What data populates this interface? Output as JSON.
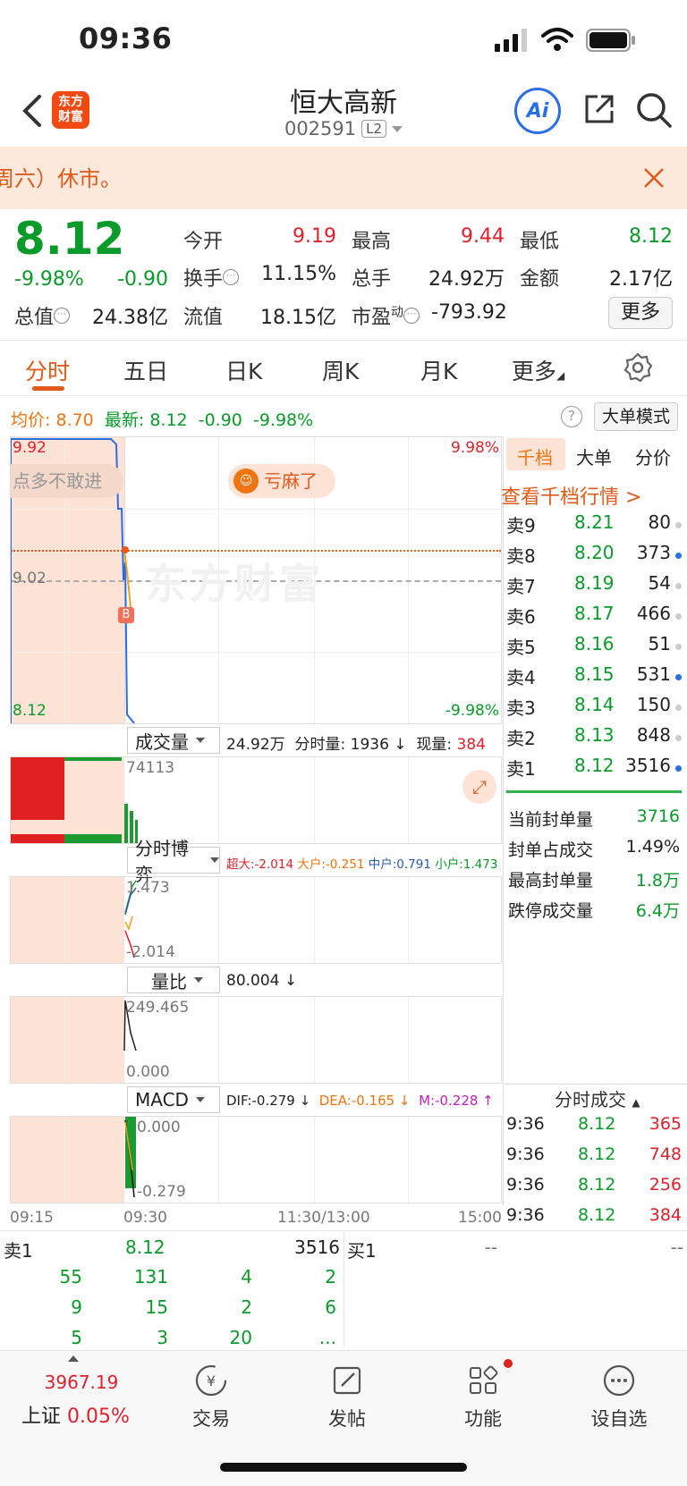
{
  "status": {
    "time": "09:36"
  },
  "header": {
    "logo_line1": "东方",
    "logo_line2": "财富",
    "title": "恒大高新",
    "code": "002591",
    "level": "L2",
    "ai_label": "Ai"
  },
  "notice": {
    "text": "周六）休市。"
  },
  "quote": {
    "price": "8.12",
    "pct": "-9.98%",
    "change": "-0.90",
    "fields": [
      {
        "label": "今开",
        "value": "9.19",
        "color": "red"
      },
      {
        "label": "最高",
        "value": "9.44",
        "color": "red"
      },
      {
        "label": "最低",
        "value": "8.12",
        "color": "green"
      },
      {
        "label": "换手",
        "value": "11.15%",
        "color": "black"
      },
      {
        "label": "总手",
        "value": "24.92万",
        "color": "black"
      },
      {
        "label": "金额",
        "value": "2.17亿",
        "color": "black"
      },
      {
        "label": "总值",
        "value": "24.38亿",
        "color": "black"
      },
      {
        "label": "流值",
        "value": "18.15亿",
        "color": "black"
      },
      {
        "label": "市盈",
        "label_sup": "动",
        "value": "-793.92",
        "color": "black"
      }
    ],
    "more": "更多"
  },
  "tabs": [
    "分时",
    "五日",
    "日K",
    "周K",
    "月K",
    "更多"
  ],
  "avg": {
    "label": "均价:",
    "value": "8.70",
    "latest_label": "最新:",
    "latest": "8.12",
    "change": "-0.90",
    "pct": "-9.98%",
    "dadan": "大单模式"
  },
  "chart": {
    "y_high": "9.92",
    "y_mid": "9.02",
    "y_low": "8.12",
    "pct_high": "9.98%",
    "pct_low": "-9.98%",
    "bubble_left": "点多不敢进",
    "bubble_mid": "亏麻了",
    "b_marker": "B",
    "watermark": "东方财富",
    "volume": {
      "label": "成交量",
      "total": "24.92万",
      "fenshi_label": "分时量:",
      "fenshi": "1936 ↓",
      "xian_label": "现量:",
      "xian": "384",
      "axis_top": "74113"
    },
    "boyi": {
      "label": "分时博弈",
      "chao": "超大:-2.014",
      "da": "大户:-0.251",
      "zhong": "中户:0.791",
      "xiao": "小户:1.473",
      "axis_top": "1.473",
      "axis_bot": "-2.014"
    },
    "liangbi": {
      "label": "量比",
      "value": "80.004 ↓",
      "axis_top": "249.465",
      "axis_bot": "0.000"
    },
    "macd": {
      "label": "MACD",
      "dif": "DIF:-0.279 ↓",
      "dea": "DEA:-0.165 ↓",
      "m": "M:-0.228 ↑",
      "axis_top": "0.000",
      "axis_bot": "-0.279"
    },
    "x_ticks": [
      "09:15",
      "09:30",
      "11:30/13:00",
      "15:00"
    ]
  },
  "right_panel": {
    "tabs": [
      "千档",
      "大单",
      "分价"
    ],
    "link": "查看千档行情 >",
    "asks": [
      {
        "label": "卖9",
        "price": "8.21",
        "vol": "80",
        "dot": "#cccccc"
      },
      {
        "label": "卖8",
        "price": "8.20",
        "vol": "373",
        "dot": "#2a6ee6"
      },
      {
        "label": "卖7",
        "price": "8.19",
        "vol": "54",
        "dot": "#cccccc"
      },
      {
        "label": "卖6",
        "price": "8.17",
        "vol": "466",
        "dot": "#cccccc"
      },
      {
        "label": "卖5",
        "price": "8.16",
        "vol": "51",
        "dot": "#cccccc"
      },
      {
        "label": "卖4",
        "price": "8.15",
        "vol": "531",
        "dot": "#2a6ee6"
      },
      {
        "label": "卖3",
        "price": "8.14",
        "vol": "150",
        "dot": "#cccccc"
      },
      {
        "label": "卖2",
        "price": "8.13",
        "vol": "848",
        "dot": "#cccccc"
      },
      {
        "label": "卖1",
        "price": "8.12",
        "vol": "3516",
        "dot": "#2a6ee6"
      }
    ],
    "stats": [
      {
        "label": "当前封单量",
        "value": "3716",
        "color": "green"
      },
      {
        "label": "封单占成交",
        "value": "1.49%",
        "color": "black"
      },
      {
        "label": "最高封单量",
        "value": "1.8万",
        "color": "green"
      },
      {
        "label": "跌停成交量",
        "value": "6.4万",
        "color": "green"
      }
    ],
    "ticks_title": "分时成交",
    "ticks": [
      {
        "time": "9:36",
        "price": "8.12",
        "vol": "365"
      },
      {
        "time": "9:36",
        "price": "8.12",
        "vol": "748"
      },
      {
        "time": "9:36",
        "price": "8.12",
        "vol": "256"
      },
      {
        "time": "9:36",
        "price": "8.12",
        "vol": "384"
      }
    ]
  },
  "queue": {
    "sell_label": "卖1",
    "sell_price": "8.12",
    "sell_vol": "3516",
    "buy_label": "买1",
    "buy_price": "--",
    "buy_vol": "--",
    "rows": [
      [
        "55",
        "131",
        "4",
        "2"
      ],
      [
        "9",
        "15",
        "2",
        "6"
      ],
      [
        "5",
        "3",
        "20",
        "..."
      ]
    ]
  },
  "nav": {
    "index_value": "3967.19",
    "index_name": "上证",
    "index_pct": "0.05%",
    "items": [
      "交易",
      "发帖",
      "功能",
      "设自选"
    ]
  }
}
